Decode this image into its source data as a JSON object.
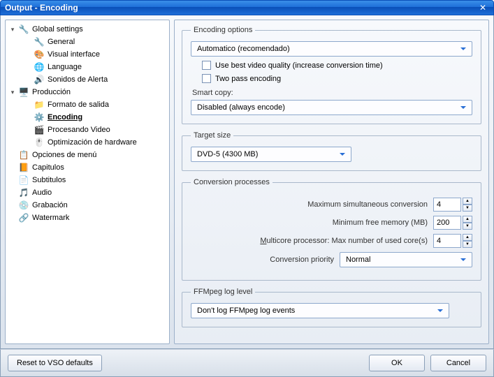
{
  "window": {
    "title": "Output - Encoding"
  },
  "sidebar": {
    "items": [
      {
        "label": "Global settings",
        "level": 0,
        "expandable": true,
        "icon": "🔧"
      },
      {
        "label": "General",
        "level": 1,
        "icon": "🔧"
      },
      {
        "label": "Visual interface",
        "level": 1,
        "icon": "🎨"
      },
      {
        "label": "Language",
        "level": 1,
        "icon": "🌐"
      },
      {
        "label": "Sonidos de Alerta",
        "level": 1,
        "icon": "🔊"
      },
      {
        "label": "Producción",
        "level": 0,
        "expandable": true,
        "icon": "🖥️"
      },
      {
        "label": "Formato de salida",
        "level": 1,
        "icon": "📁"
      },
      {
        "label": "Encoding",
        "level": 1,
        "icon": "⚙️",
        "selected": true
      },
      {
        "label": "Procesando Video",
        "level": 1,
        "icon": "🎬"
      },
      {
        "label": "Optimización de hardware",
        "level": 1,
        "icon": "🖱️"
      },
      {
        "label": "Opciones de menú",
        "level": 0,
        "icon": "📋"
      },
      {
        "label": "Capitulos",
        "level": 0,
        "icon": "📙"
      },
      {
        "label": "Subtitulos",
        "level": 0,
        "icon": "📄"
      },
      {
        "label": "Audio",
        "level": 0,
        "icon": "🎵"
      },
      {
        "label": "Grabación",
        "level": 0,
        "icon": "💿"
      },
      {
        "label": "Watermark",
        "level": 0,
        "icon": "🔗"
      }
    ]
  },
  "encoding_options": {
    "legend": "Encoding options",
    "mode_value": "Automatico (recomendado)",
    "best_quality_label": "Use best video quality (increase conversion time)",
    "two_pass_label": "Two pass encoding",
    "smart_copy_label": "Smart copy:",
    "smart_copy_value": "Disabled (always encode)"
  },
  "target_size": {
    "legend": "Target size",
    "value": "DVD-5 (4300 MB)"
  },
  "conversion": {
    "legend": "Conversion processes",
    "max_sim_label": "Maximum simultaneous conversion",
    "max_sim_value": "4",
    "min_mem_label": "Minimum free memory (MB)",
    "min_mem_value": "200",
    "multicore_label_prefix": "M",
    "multicore_label_rest": "ulticore processor: Max number of used core(s)",
    "multicore_value": "4",
    "priority_label": "Conversion priority",
    "priority_value": "Normal"
  },
  "ffmpeg": {
    "legend": "FFMpeg log level",
    "value": "Don't log FFMpeg log events"
  },
  "footer": {
    "reset_label": "Reset to VSO defaults",
    "ok_label": "OK",
    "cancel_label": "Cancel"
  }
}
